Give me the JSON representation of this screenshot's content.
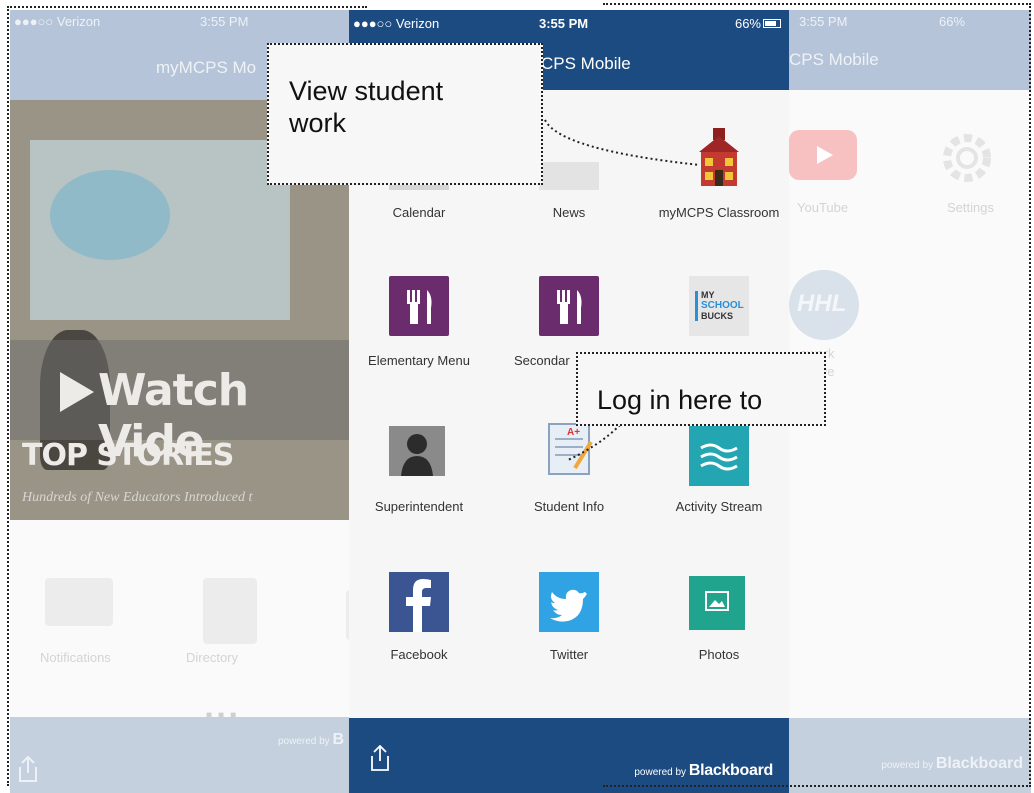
{
  "left_screen": {
    "status_carrier": "●●●○○ Verizon",
    "status_time": "3:55 PM",
    "title": "myMCPS Mo",
    "video_text": "Watch Vide",
    "section_title": "TOP STORIES",
    "headline": "Hundreds of New Educators Introduced t",
    "tiles": [
      {
        "label": "Notifications"
      },
      {
        "label": "Directory"
      }
    ],
    "powered_prefix": "powered by",
    "powered_brand": "B"
  },
  "main_screen": {
    "status_carrier": "●●●○○ Verizon",
    "status_time": "3:55 PM",
    "status_battery": "66%",
    "title": "CPS Mobile",
    "tiles": [
      {
        "label": "Calendar"
      },
      {
        "label": "News"
      },
      {
        "label": "myMCPS Classroom"
      },
      {
        "label": "Elementary Menu"
      },
      {
        "label": "Secondar"
      },
      {
        "label": "MY SCHOOL BUCKS"
      },
      {
        "label": "Superintendent"
      },
      {
        "label": "Student Info"
      },
      {
        "label": "Activity Stream"
      },
      {
        "label": "Facebook"
      },
      {
        "label": "Twitter"
      },
      {
        "label": "Photos"
      }
    ],
    "bucks_icon_text": {
      "my": "MY",
      "school": "SCHOOL",
      "bucks": "BUCKS"
    },
    "grade_badge": "A+",
    "powered_prefix": "powered by",
    "powered_brand": "Blackboard"
  },
  "right_screen": {
    "status_time": "3:55 PM",
    "status_battery": "66%",
    "title": "CPS Mobile",
    "tiles": [
      {
        "label": "YouTube"
      },
      {
        "label": "Settings"
      },
      {
        "label": "...ework"
      },
      {
        "label": "...e Live"
      }
    ],
    "hhl_text": "HHL",
    "powered_prefix": "powered by",
    "powered_brand": "Blackboard"
  },
  "callouts": {
    "view_work": {
      "line1": "View student",
      "line2": "work"
    },
    "log_in": "Log in here to"
  },
  "colors": {
    "navbar": "#1c4b82",
    "purple_icon": "#6b2c6e",
    "teal_icon": "#23a6b1",
    "facebook": "#3a5592",
    "twitter": "#2fa3e3",
    "photos": "#20a48e"
  }
}
